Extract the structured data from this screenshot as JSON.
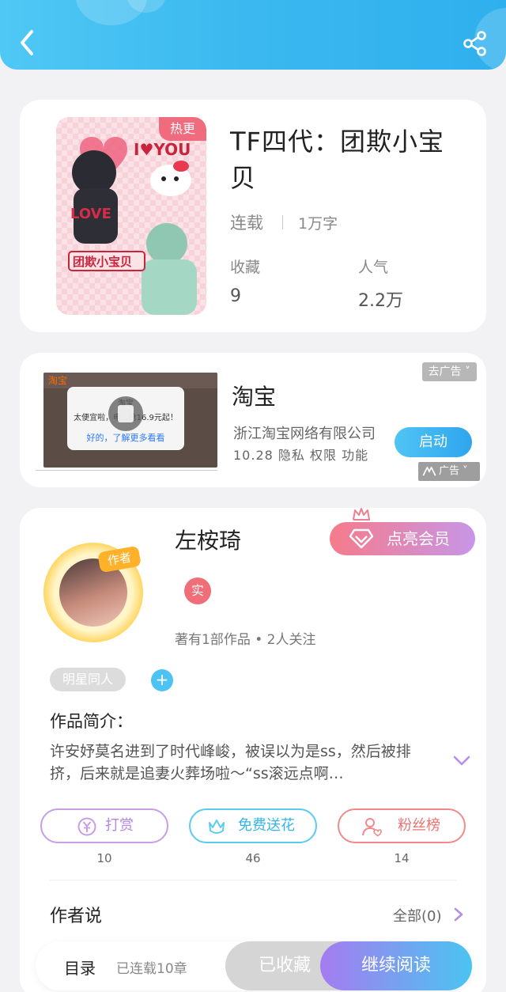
{
  "book": {
    "cover_badge": "热更",
    "title": "TF四代：团欺小宝贝",
    "status": "连载",
    "word_count": "1万字",
    "collect_label": "收藏",
    "collect_value": "9",
    "popularity_label": "人气",
    "popularity_value": "2.2万"
  },
  "ad": {
    "image_label": "淘宝",
    "dialog_line1": "淘宝",
    "dialog_line2": "太便宜啦，电...抢16.9元起！",
    "dialog_link": "好的，了解更多看看",
    "title": "淘宝",
    "company": "浙江淘宝网络有限公司",
    "meta": "10.28  隐私  权限  功能",
    "remove_ad": "去广告 ˅",
    "launch": "启动",
    "ad_tag": "广告 ˅"
  },
  "author": {
    "badge": "作者",
    "name": "左桉琦",
    "vip_button": "点亮会员",
    "real_badge": "实",
    "stats": "著有1部作品 • 2人关注",
    "tag": "明星同人",
    "add_tag": "+",
    "intro_title": "作品简介：",
    "intro_text": "许安妤莫名进到了时代峰峻，被误以为是ss，然后被排挤，后来就是追妻火葬场啦～“ss滚远点啊…",
    "actions": [
      {
        "label": "打赏",
        "count": "10",
        "color": "#c79ee6"
      },
      {
        "label": "免费送花",
        "count": "46",
        "color": "#5bcbef"
      },
      {
        "label": "粉丝榜",
        "count": "14",
        "color": "#f08a8a"
      }
    ],
    "author_says": "作者说",
    "all_link": "全部(0)"
  },
  "bottom": {
    "toc": "目录",
    "serial_info": "已连载10章",
    "collected": "已收藏",
    "continue_read": "继续阅读"
  },
  "colors": {
    "header_blue": "#3ab8ef",
    "vip_pink": "#f57b8a",
    "read_gradient_end": "#4ac4f1"
  }
}
